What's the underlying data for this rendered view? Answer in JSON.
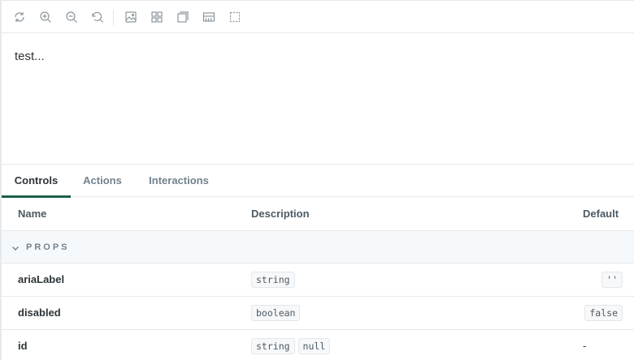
{
  "toolbar": {
    "buttons": [
      {
        "name": "remount-icon"
      },
      {
        "name": "zoom-in-icon"
      },
      {
        "name": "zoom-out-icon"
      },
      {
        "name": "reset-zoom-icon"
      },
      {
        "name": "background-icon"
      },
      {
        "name": "grid-icon"
      },
      {
        "name": "viewport-icon"
      },
      {
        "name": "measure-icon"
      },
      {
        "name": "outline-icon"
      }
    ]
  },
  "preview": {
    "text": "test..."
  },
  "tabs": [
    {
      "label": "Controls",
      "active": true
    },
    {
      "label": "Actions",
      "active": false
    },
    {
      "label": "Interactions",
      "active": false
    }
  ],
  "table": {
    "headers": {
      "name": "Name",
      "description": "Description",
      "default": "Default"
    },
    "section": "PROPS",
    "rows": [
      {
        "name": "ariaLabel",
        "types": [
          "string"
        ],
        "default": "''"
      },
      {
        "name": "disabled",
        "types": [
          "boolean"
        ],
        "default": "false"
      },
      {
        "name": "id",
        "types": [
          "string",
          "null"
        ],
        "default": "-"
      }
    ]
  },
  "colors": {
    "accent": "#1d5f4a",
    "section_bg": "#f6f9fc",
    "muted": "#73828c"
  }
}
